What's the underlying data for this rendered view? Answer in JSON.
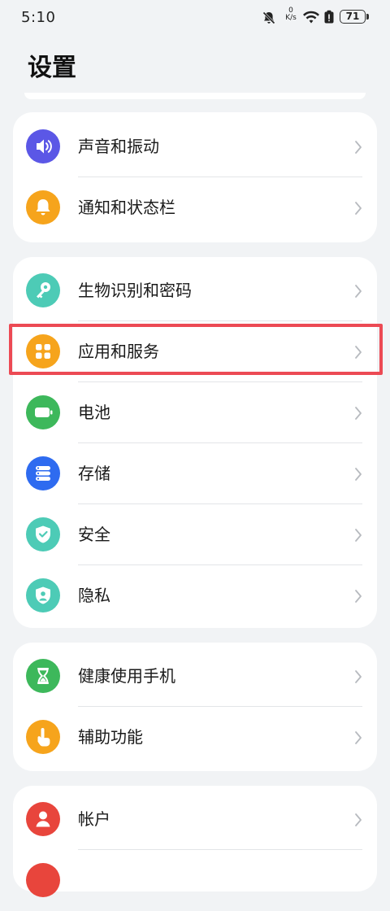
{
  "status_bar": {
    "time": "5:10",
    "net_speed_value": "0",
    "net_speed_unit": "K/s",
    "battery": "71",
    "icons": [
      "mute-icon",
      "wifi-icon",
      "battery-saver-icon",
      "battery-icon"
    ]
  },
  "header": {
    "title": "设置"
  },
  "groups": [
    {
      "items": [
        {
          "label": "声音和振动",
          "icon": "sound-icon",
          "color": "#5b57e6"
        },
        {
          "label": "通知和状态栏",
          "icon": "bell-icon",
          "color": "#f6a41c"
        }
      ]
    },
    {
      "items": [
        {
          "label": "生物识别和密码",
          "icon": "key-icon",
          "color": "#4dcbb6"
        },
        {
          "label": "应用和服务",
          "icon": "apps-icon",
          "color": "#f6a41c",
          "highlighted": true
        },
        {
          "label": "电池",
          "icon": "battery-icon",
          "color": "#3db85b"
        },
        {
          "label": "存储",
          "icon": "storage-icon",
          "color": "#2e6bf0"
        },
        {
          "label": "安全",
          "icon": "shield-icon",
          "color": "#4dcbb6"
        },
        {
          "label": "隐私",
          "icon": "privacy-icon",
          "color": "#4dcbb6"
        }
      ]
    },
    {
      "items": [
        {
          "label": "健康使用手机",
          "icon": "hourglass-icon",
          "color": "#3db85b"
        },
        {
          "label": "辅助功能",
          "icon": "hand-icon",
          "color": "#f6a41c"
        }
      ]
    },
    {
      "items": [
        {
          "label": "帐户",
          "icon": "account-icon",
          "color": "#e8453c"
        }
      ]
    }
  ],
  "accent_highlight_color": "#ec4a54"
}
